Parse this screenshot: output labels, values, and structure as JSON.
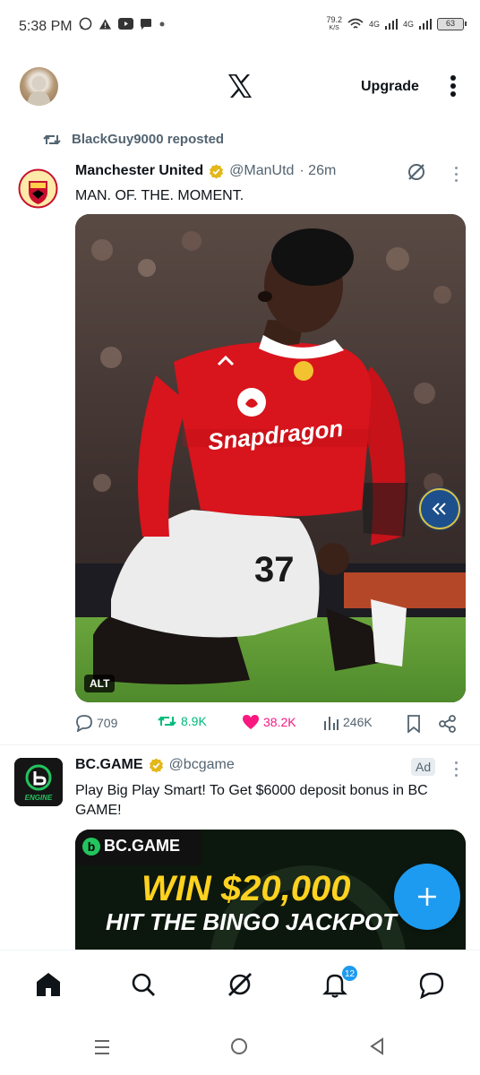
{
  "status_bar": {
    "time": "5:38 PM",
    "net_speed_value": "79.2",
    "net_speed_unit": "K/S",
    "net_1": "4G",
    "net_2": "4G",
    "battery": "63"
  },
  "header": {
    "upgrade_label": "Upgrade"
  },
  "post1": {
    "reposted_by": "BlackGuy9000 reposted",
    "author_name": "Manchester United",
    "handle": "@ManUtd",
    "time": "· 26m",
    "text": "MAN. OF. THE. MOMENT.",
    "alt_label": "ALT",
    "replies": "709",
    "reposts": "8.9K",
    "likes": "38.2K",
    "views": "246K",
    "shirt_sponsor": "Snapdragon",
    "shirt_number": "37"
  },
  "ad_post": {
    "author_name": "BC.GAME",
    "handle": "@bcgame",
    "ad_label": "Ad",
    "text": "Play Big Play Smart! To Get $6000 deposit bonus in BC GAME!",
    "avatar_label": "ENGINE",
    "banner_logo": "BC.GAME",
    "banner_headline": "WIN $20,000",
    "banner_sub": "HIT THE BINGO JACKPOT"
  },
  "bottom_nav": {
    "notifications_count": "12"
  },
  "colors": {
    "accent": "#1d9bf0",
    "retweet": "#00ba7c",
    "like": "#f91880",
    "secondary_text": "#536471"
  }
}
